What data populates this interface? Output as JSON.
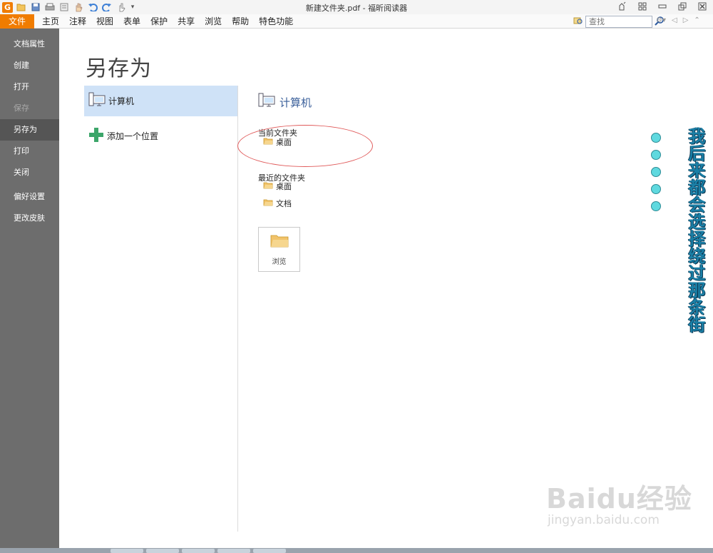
{
  "window": {
    "title": "新建文件夹.pdf - 福昕阅读器",
    "app_logo": "G"
  },
  "menubar": {
    "file": "文件",
    "items": [
      "主页",
      "注释",
      "视图",
      "表单",
      "保护",
      "共享",
      "浏览",
      "帮助",
      "特色功能"
    ],
    "search_placeholder": "查找"
  },
  "sidebar": {
    "items": [
      "文档属性",
      "创建",
      "打开",
      "保存",
      "另存为",
      "打印",
      "关闭"
    ],
    "extra": [
      "偏好设置",
      "更改皮肤"
    ]
  },
  "page": {
    "title": "另存为"
  },
  "places": {
    "computer": "计算机",
    "add": "添加一个位置"
  },
  "right": {
    "header": "计算机",
    "current_label": "当前文件夹",
    "current_folder": "桌面",
    "recent_label": "最近的文件夹",
    "recent": [
      "桌面",
      "文档"
    ],
    "browse": "浏览"
  },
  "overlay": {
    "vertical_text": "我后来都会选择绕过那条街"
  },
  "watermark": {
    "main": "Baidu经验",
    "sub": "jingyan.baidu.com"
  }
}
